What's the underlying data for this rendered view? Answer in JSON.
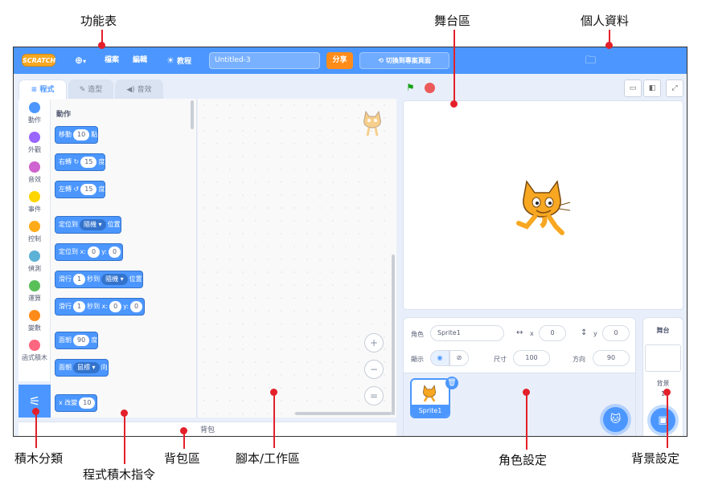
{
  "annotations": {
    "menu_bar": "功能表",
    "stage_area": "舞台區",
    "profile": "個人資料",
    "block_categories": "積木分類",
    "block_palette": "程式積木指令",
    "backpack_area": "背包區",
    "script_area": "腳本/工作區",
    "sprite_settings": "角色設定",
    "backdrop_settings": "背景設定"
  },
  "menubar": {
    "logo": "SCRATCH",
    "globe_caret": "▾",
    "file": "檔案",
    "edit": "編輯",
    "tutorials": "教程",
    "project_title": "Untitled-3",
    "share": "分享",
    "switch_project_page": "切換到專案頁面",
    "bg_color": "#4c97ff"
  },
  "tabs": {
    "code": "程式",
    "costumes": "造型",
    "sounds": "音效"
  },
  "categories": [
    {
      "label": "動作",
      "color": "#4c97ff"
    },
    {
      "label": "外觀",
      "color": "#9966ff"
    },
    {
      "label": "音效",
      "color": "#cf63cf"
    },
    {
      "label": "事件",
      "color": "#ffd500"
    },
    {
      "label": "控制",
      "color": "#ffab19"
    },
    {
      "label": "偵測",
      "color": "#5cb1d6"
    },
    {
      "label": "運算",
      "color": "#59c059"
    },
    {
      "label": "變數",
      "color": "#ff8c1a"
    },
    {
      "label": "函式積木",
      "color": "#ff6680"
    }
  ],
  "palette": {
    "section_title": "動作",
    "move": {
      "pre": "移動",
      "value": "10",
      "post": "點"
    },
    "turn_right": {
      "pre": "右轉",
      "value": "15",
      "post": "度"
    },
    "turn_left": {
      "pre": "左轉",
      "value": "15",
      "post": "度"
    },
    "goto": {
      "pre": "定位到",
      "dropdown": "隨機 ▾",
      "post": "位置"
    },
    "goto_xy": {
      "pre": "定位到 x:",
      "x": "0",
      "mid": "y:",
      "y": "0"
    },
    "glide_to": {
      "pre": "滑行",
      "secs": "1",
      "mid": "秒到",
      "dropdown": "隨機 ▾",
      "post": "位置"
    },
    "glide_xy": {
      "pre": "滑行",
      "secs": "1",
      "mid": "秒到 x:",
      "x": "0",
      "mid2": "y:",
      "y": "0"
    },
    "point_dir": {
      "pre": "面朝",
      "value": "90",
      "post": "度"
    },
    "point_towards": {
      "pre": "面朝",
      "dropdown": "鼠標 ▾",
      "post": "向"
    },
    "change_x": {
      "pre": "x 改變",
      "value": "10"
    }
  },
  "script_area": {
    "zoom_in": "+",
    "zoom_out": "−",
    "zoom_reset": "="
  },
  "backpack": "背包",
  "sprite_info": {
    "sprite_label": "角色",
    "sprite_name": "Sprite1",
    "x_label": "x",
    "x_value": "0",
    "y_label": "y",
    "y_value": "0",
    "show_label": "顯示",
    "size_label": "尺寸",
    "size_value": "100",
    "direction_label": "方向",
    "direction_value": "90"
  },
  "sprite_list": {
    "thumb_name": "Sprite1"
  },
  "stage_panel": {
    "title": "舞台",
    "backdrops_label": "背景",
    "backdrops_count": "1"
  }
}
